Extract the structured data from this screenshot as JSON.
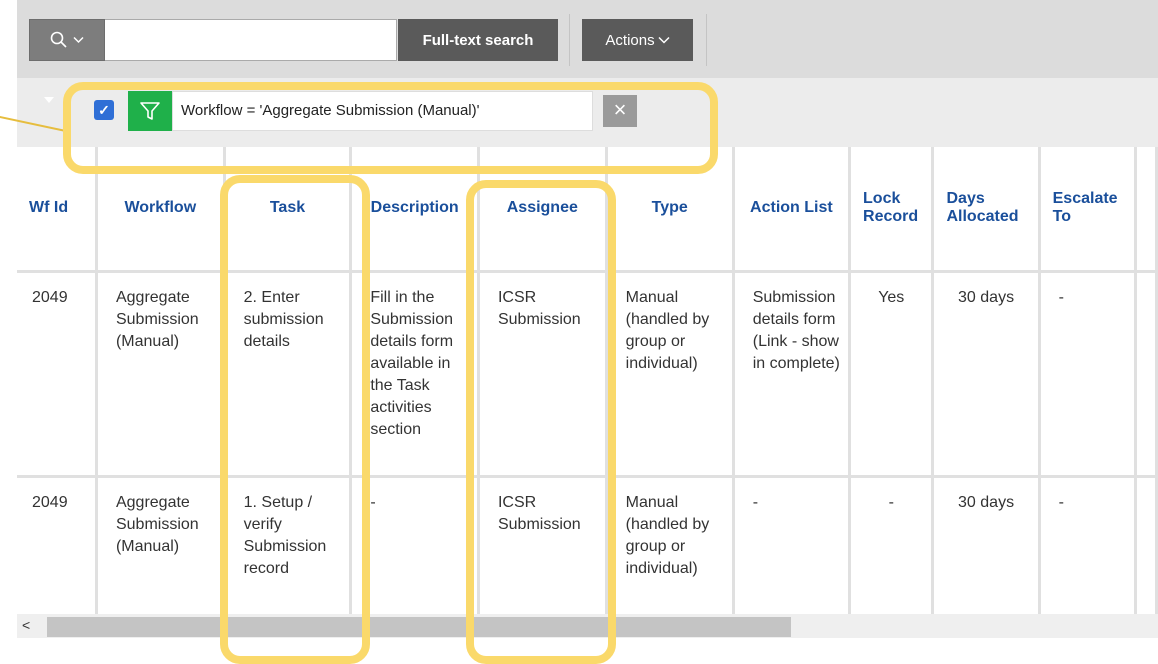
{
  "toolbar": {
    "search_icon": "search-icon",
    "fulltext_label": "Full-text search",
    "actions_label": "Actions",
    "search_value": ""
  },
  "filter": {
    "checked": true,
    "text": "Workflow = 'Aggregate Submission (Manual)'",
    "remove_symbol": "×",
    "check_symbol": "✓"
  },
  "table": {
    "headers": {
      "wfid": "Wf Id",
      "workflow": "Workflow",
      "task": "Task",
      "description": "Description",
      "assignee": "Assignee",
      "type": "Type",
      "action_list": "Action List",
      "lock_record": "Lock Record",
      "days_allocated": "Days Allocated",
      "escalate_to": "Escalate To"
    },
    "rows": [
      {
        "wfid": "2049",
        "workflow": "Aggregate Submission (Manual)",
        "task": "2. Enter submission details",
        "description": "Fill in the Submission details form available in the Task activities section",
        "assignee": "ICSR Submission",
        "type": "Manual (handled by group or individual)",
        "action_list": "Submission details form (Link - show in complete)",
        "lock_record": "Yes",
        "days_allocated": "30 days",
        "escalate_to": "-"
      },
      {
        "wfid": "2049",
        "workflow": "Aggregate Submission (Manual)",
        "task": "1. Setup / verify Submission record",
        "description": "-",
        "assignee": "ICSR Submission",
        "type": "Manual (handled by group or individual)",
        "action_list": "-",
        "lock_record": "-",
        "days_allocated": "30 days",
        "escalate_to": "-"
      }
    ]
  },
  "scrollbar": {
    "left_arrow": "<"
  },
  "colors": {
    "header_text": "#1a4f9b",
    "filter_green": "#1fb04a",
    "checkbox_blue": "#2f6fd6",
    "highlight": "#fad96b"
  }
}
